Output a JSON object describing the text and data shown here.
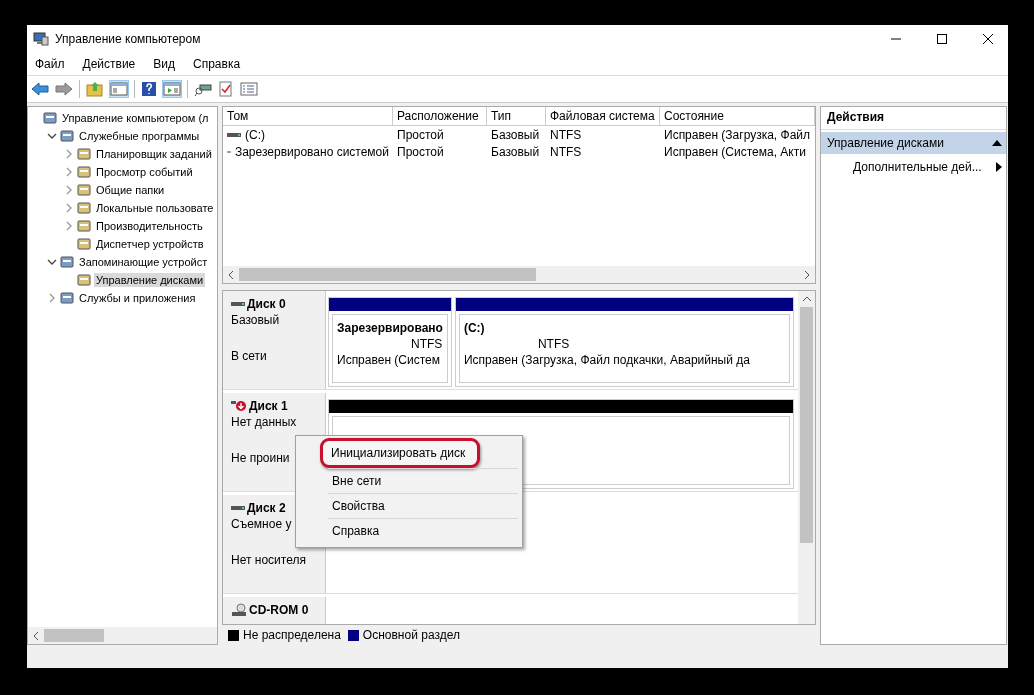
{
  "window": {
    "title": "Управление компьютером"
  },
  "menu": [
    "Файл",
    "Действие",
    "Вид",
    "Справка"
  ],
  "tree": [
    {
      "label": "Управление компьютером (л",
      "selected": false,
      "children": [
        {
          "label": "Служебные программы",
          "selected": false,
          "expanded": true,
          "children": [
            {
              "label": "Планировщик заданий",
              "selected": false,
              "expanded": false
            },
            {
              "label": "Просмотр событий",
              "selected": false,
              "expanded": false
            },
            {
              "label": "Общие папки",
              "selected": false,
              "expanded": false
            },
            {
              "label": "Локальные пользовате",
              "selected": false,
              "expanded": false
            },
            {
              "label": "Производительность",
              "selected": false,
              "expanded": false
            },
            {
              "label": "Диспетчер устройств",
              "selected": false
            }
          ]
        },
        {
          "label": "Запоминающие устройст",
          "selected": false,
          "expanded": true,
          "children": [
            {
              "label": "Управление дисками",
              "selected": true
            }
          ]
        },
        {
          "label": "Службы и приложения",
          "selected": false,
          "expanded": false
        }
      ]
    }
  ],
  "volumes": {
    "columns": [
      "Том",
      "Расположение",
      "Тип",
      "Файловая система",
      "Состояние"
    ],
    "rows": [
      [
        "(C:)",
        "Простой",
        "Базовый",
        "NTFS",
        "Исправен (Загрузка, Файл"
      ],
      [
        "Зарезервировано системой",
        "Простой",
        "Базовый",
        "NTFS",
        "Исправен (Система, Акти"
      ]
    ]
  },
  "disks": [
    {
      "kind": "basic",
      "name": "Диск 0",
      "lines": [
        "Базовый",
        "В сети"
      ],
      "partitions": [
        {
          "title": "Зарезервировано",
          "fs": "NTFS",
          "status": "Исправен (Систем",
          "color": "#000080"
        },
        {
          "title": "(C:)",
          "fs": "NTFS",
          "status": "Исправен (Загрузка, Файл подкачки, Аварийный да",
          "color": "#000080"
        }
      ]
    },
    {
      "kind": "uninitialized",
      "name": "Диск 1",
      "lines": [
        "Нет данных",
        "Не проини"
      ],
      "partitions": [
        {
          "color": "#000000"
        }
      ]
    },
    {
      "kind": "removable",
      "name": "Диск 2",
      "lines": [
        "Съемное у",
        "Нет носителя"
      ]
    },
    {
      "kind": "cdrom",
      "name": "CD-ROM 0"
    }
  ],
  "context_menu": [
    {
      "label": "Инициализировать диск",
      "selected": true
    },
    {
      "label": "Вне сети",
      "selected": false
    },
    {
      "label": "Свойства",
      "selected": false
    },
    {
      "label": "Справка",
      "selected": false
    }
  ],
  "legend": [
    {
      "label": "Не распределена",
      "color": "#000000"
    },
    {
      "label": "Основной раздел",
      "color": "#000080"
    }
  ],
  "actions": {
    "title": "Действия",
    "section": {
      "label": "Управление дисками",
      "expanded": true
    },
    "items": [
      "Дополнительные дей..."
    ]
  }
}
